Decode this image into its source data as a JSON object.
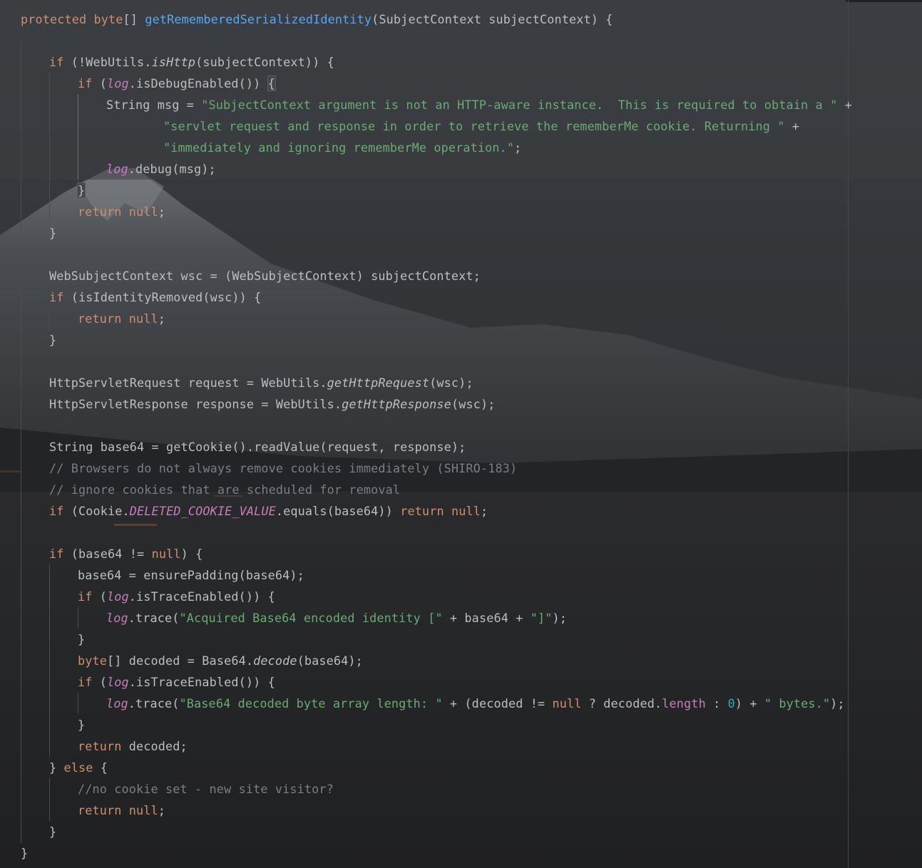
{
  "editor": {
    "language": "java",
    "colors": {
      "background": "#2a2c2f",
      "keyword": "#cf8e6d",
      "function": "#56a8f5",
      "string": "#6aab73",
      "field": "#c77dbb",
      "number": "#2aacb8",
      "comment": "#7a7e85",
      "text": "#bcbec4"
    },
    "lines": [
      {
        "indent": 0,
        "tokens": [
          {
            "c": "kw",
            "t": "protected byte"
          },
          {
            "c": "plain",
            "t": "[] "
          },
          {
            "c": "fn",
            "t": "getRememberedSerializedIdentity"
          },
          {
            "c": "plain",
            "t": "(SubjectContext subjectContext) {"
          }
        ]
      },
      {
        "indent": 0,
        "tokens": []
      },
      {
        "indent": 1,
        "tokens": [
          {
            "c": "kw",
            "t": "if "
          },
          {
            "c": "plain",
            "t": "(!WebUtils."
          },
          {
            "c": "static",
            "t": "isHttp"
          },
          {
            "c": "plain",
            "t": "(subjectContext)) {"
          }
        ]
      },
      {
        "indent": 2,
        "tokens": [
          {
            "c": "kw",
            "t": "if "
          },
          {
            "c": "plain",
            "t": "("
          },
          {
            "c": "field",
            "t": "log"
          },
          {
            "c": "plain",
            "t": ".isDebugEnabled()) "
          },
          {
            "c": "brace",
            "t": "{"
          }
        ]
      },
      {
        "indent": 3,
        "tokens": [
          {
            "c": "plain",
            "t": "String msg = "
          },
          {
            "c": "str",
            "t": "\"SubjectContext argument is not an HTTP-aware instance.  This is required to obtain a \""
          },
          {
            "c": "plain",
            "t": " +"
          }
        ]
      },
      {
        "indent": 5,
        "tokens": [
          {
            "c": "str",
            "t": "\"servlet request and response in order to retrieve the rememberMe cookie. Returning \""
          },
          {
            "c": "plain",
            "t": " +"
          }
        ]
      },
      {
        "indent": 5,
        "tokens": [
          {
            "c": "str",
            "t": "\"immediately and ignoring rememberMe operation.\""
          },
          {
            "c": "plain",
            "t": ";"
          }
        ]
      },
      {
        "indent": 3,
        "tokens": [
          {
            "c": "field",
            "t": "log"
          },
          {
            "c": "plain",
            "t": ".debug(msg);"
          }
        ]
      },
      {
        "indent": 2,
        "tokens": [
          {
            "c": "brace",
            "t": "}"
          }
        ]
      },
      {
        "indent": 2,
        "tokens": [
          {
            "c": "kw",
            "t": "return null"
          },
          {
            "c": "plain",
            "t": ";"
          }
        ]
      },
      {
        "indent": 1,
        "tokens": [
          {
            "c": "plain",
            "t": "}"
          }
        ]
      },
      {
        "indent": 0,
        "tokens": []
      },
      {
        "indent": 1,
        "tokens": [
          {
            "c": "plain",
            "t": "WebSubjectContext wsc = (WebSubjectContext) subjectContext;"
          }
        ]
      },
      {
        "indent": 1,
        "tokens": [
          {
            "c": "kw",
            "t": "if "
          },
          {
            "c": "plain",
            "t": "(isIdentityRemoved(wsc)) {"
          }
        ]
      },
      {
        "indent": 2,
        "tokens": [
          {
            "c": "kw",
            "t": "return null"
          },
          {
            "c": "plain",
            "t": ";"
          }
        ]
      },
      {
        "indent": 1,
        "tokens": [
          {
            "c": "plain",
            "t": "}"
          }
        ]
      },
      {
        "indent": 0,
        "tokens": []
      },
      {
        "indent": 1,
        "tokens": [
          {
            "c": "plain",
            "t": "HttpServletRequest request = WebUtils."
          },
          {
            "c": "static",
            "t": "getHttpRequest"
          },
          {
            "c": "plain",
            "t": "(wsc);"
          }
        ]
      },
      {
        "indent": 1,
        "tokens": [
          {
            "c": "plain",
            "t": "HttpServletResponse response = WebUtils."
          },
          {
            "c": "static",
            "t": "getHttpResponse"
          },
          {
            "c": "plain",
            "t": "(wsc);"
          }
        ]
      },
      {
        "indent": 0,
        "tokens": []
      },
      {
        "indent": 1,
        "tokens": [
          {
            "c": "plain",
            "t": "String base64 = getCookie().readValue(request, response);"
          }
        ]
      },
      {
        "indent": 1,
        "tokens": [
          {
            "c": "cmt",
            "t": "// Browsers do not always remove cookies immediately (SHIRO-183)"
          }
        ]
      },
      {
        "indent": 1,
        "tokens": [
          {
            "c": "cmt",
            "t": "// ignore cookies that are scheduled for removal"
          }
        ]
      },
      {
        "indent": 1,
        "tokens": [
          {
            "c": "kw",
            "t": "if "
          },
          {
            "c": "plain",
            "t": "(Cookie."
          },
          {
            "c": "const",
            "t": "DELETED_COOKIE_VALUE"
          },
          {
            "c": "plain",
            "t": ".equals(base64)) "
          },
          {
            "c": "kw",
            "t": "return null"
          },
          {
            "c": "plain",
            "t": ";"
          }
        ]
      },
      {
        "indent": 0,
        "tokens": []
      },
      {
        "indent": 1,
        "tokens": [
          {
            "c": "kw",
            "t": "if "
          },
          {
            "c": "plain",
            "t": "(base64 != "
          },
          {
            "c": "kw",
            "t": "null"
          },
          {
            "c": "plain",
            "t": ") {"
          }
        ]
      },
      {
        "indent": 2,
        "tokens": [
          {
            "c": "plain",
            "t": "base64 = ensurePadding(base64);"
          }
        ]
      },
      {
        "indent": 2,
        "tokens": [
          {
            "c": "kw",
            "t": "if "
          },
          {
            "c": "plain",
            "t": "("
          },
          {
            "c": "field",
            "t": "log"
          },
          {
            "c": "plain",
            "t": ".isTraceEnabled()) {"
          }
        ]
      },
      {
        "indent": 3,
        "tokens": [
          {
            "c": "field",
            "t": "log"
          },
          {
            "c": "plain",
            "t": ".trace("
          },
          {
            "c": "str",
            "t": "\"Acquired Base64 encoded identity [\""
          },
          {
            "c": "plain",
            "t": " + base64 + "
          },
          {
            "c": "str",
            "t": "\"]\""
          },
          {
            "c": "plain",
            "t": ");"
          }
        ]
      },
      {
        "indent": 2,
        "tokens": [
          {
            "c": "plain",
            "t": "}"
          }
        ]
      },
      {
        "indent": 2,
        "tokens": [
          {
            "c": "kw",
            "t": "byte"
          },
          {
            "c": "plain",
            "t": "[] decoded = Base64."
          },
          {
            "c": "static",
            "t": "decode"
          },
          {
            "c": "plain",
            "t": "(base64);"
          }
        ]
      },
      {
        "indent": 2,
        "tokens": [
          {
            "c": "kw",
            "t": "if "
          },
          {
            "c": "plain",
            "t": "("
          },
          {
            "c": "field",
            "t": "log"
          },
          {
            "c": "plain",
            "t": ".isTraceEnabled()) {"
          }
        ]
      },
      {
        "indent": 3,
        "tokens": [
          {
            "c": "field",
            "t": "log"
          },
          {
            "c": "plain",
            "t": ".trace("
          },
          {
            "c": "str",
            "t": "\"Base64 decoded byte array length: \""
          },
          {
            "c": "plain",
            "t": " + (decoded != "
          },
          {
            "c": "kw",
            "t": "null"
          },
          {
            "c": "plain",
            "t": " ? decoded."
          },
          {
            "c": "prop",
            "t": "length"
          },
          {
            "c": "plain",
            "t": " : "
          },
          {
            "c": "num",
            "t": "0"
          },
          {
            "c": "plain",
            "t": ") + "
          },
          {
            "c": "str",
            "t": "\" bytes.\""
          },
          {
            "c": "plain",
            "t": ");"
          }
        ]
      },
      {
        "indent": 2,
        "tokens": [
          {
            "c": "plain",
            "t": "}"
          }
        ]
      },
      {
        "indent": 2,
        "tokens": [
          {
            "c": "kw",
            "t": "return "
          },
          {
            "c": "plain",
            "t": "decoded;"
          }
        ]
      },
      {
        "indent": 1,
        "tokens": [
          {
            "c": "plain",
            "t": "} "
          },
          {
            "c": "kw",
            "t": "else "
          },
          {
            "c": "plain",
            "t": "{"
          }
        ]
      },
      {
        "indent": 2,
        "tokens": [
          {
            "c": "cmt",
            "t": "//no cookie set - new site visitor?"
          }
        ]
      },
      {
        "indent": 2,
        "tokens": [
          {
            "c": "kw",
            "t": "return null"
          },
          {
            "c": "plain",
            "t": ";"
          }
        ]
      },
      {
        "indent": 1,
        "tokens": [
          {
            "c": "plain",
            "t": "}"
          }
        ]
      },
      {
        "indent": 0,
        "tokens": [
          {
            "c": "plain",
            "t": "}"
          }
        ]
      }
    ]
  }
}
